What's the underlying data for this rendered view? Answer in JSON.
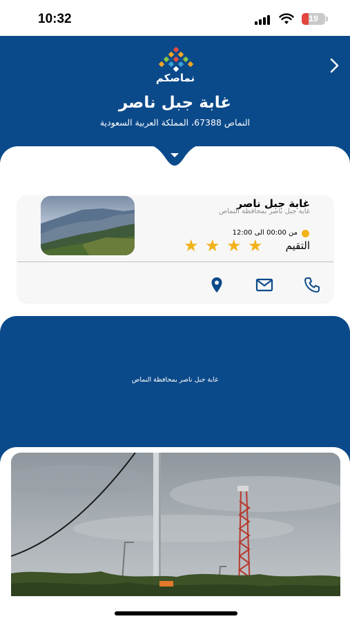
{
  "status": {
    "time": "10:32",
    "battery": "19"
  },
  "header": {
    "brand": "نماصكم",
    "title": "غابة جبل ناصر",
    "address": "النماص 67388، المملكة العربية السعودية"
  },
  "card": {
    "name": "غابة جبل ناصر",
    "description": "غابة جبل ناصر بمحافظة النماص",
    "hours": "من 00:00 الى 12:00",
    "rating_label": "التقيم",
    "rating": 4
  },
  "about": {
    "text": "غابة جبل ناصر بمحافظة النماص"
  },
  "colors": {
    "primary": "#0b4a8a",
    "star": "#f2b21a",
    "battery_low": "#e2463f"
  },
  "icons": [
    "back-chevron-icon",
    "location-pin-icon",
    "mail-icon",
    "phone-icon",
    "clock-icon",
    "star-icon"
  ]
}
